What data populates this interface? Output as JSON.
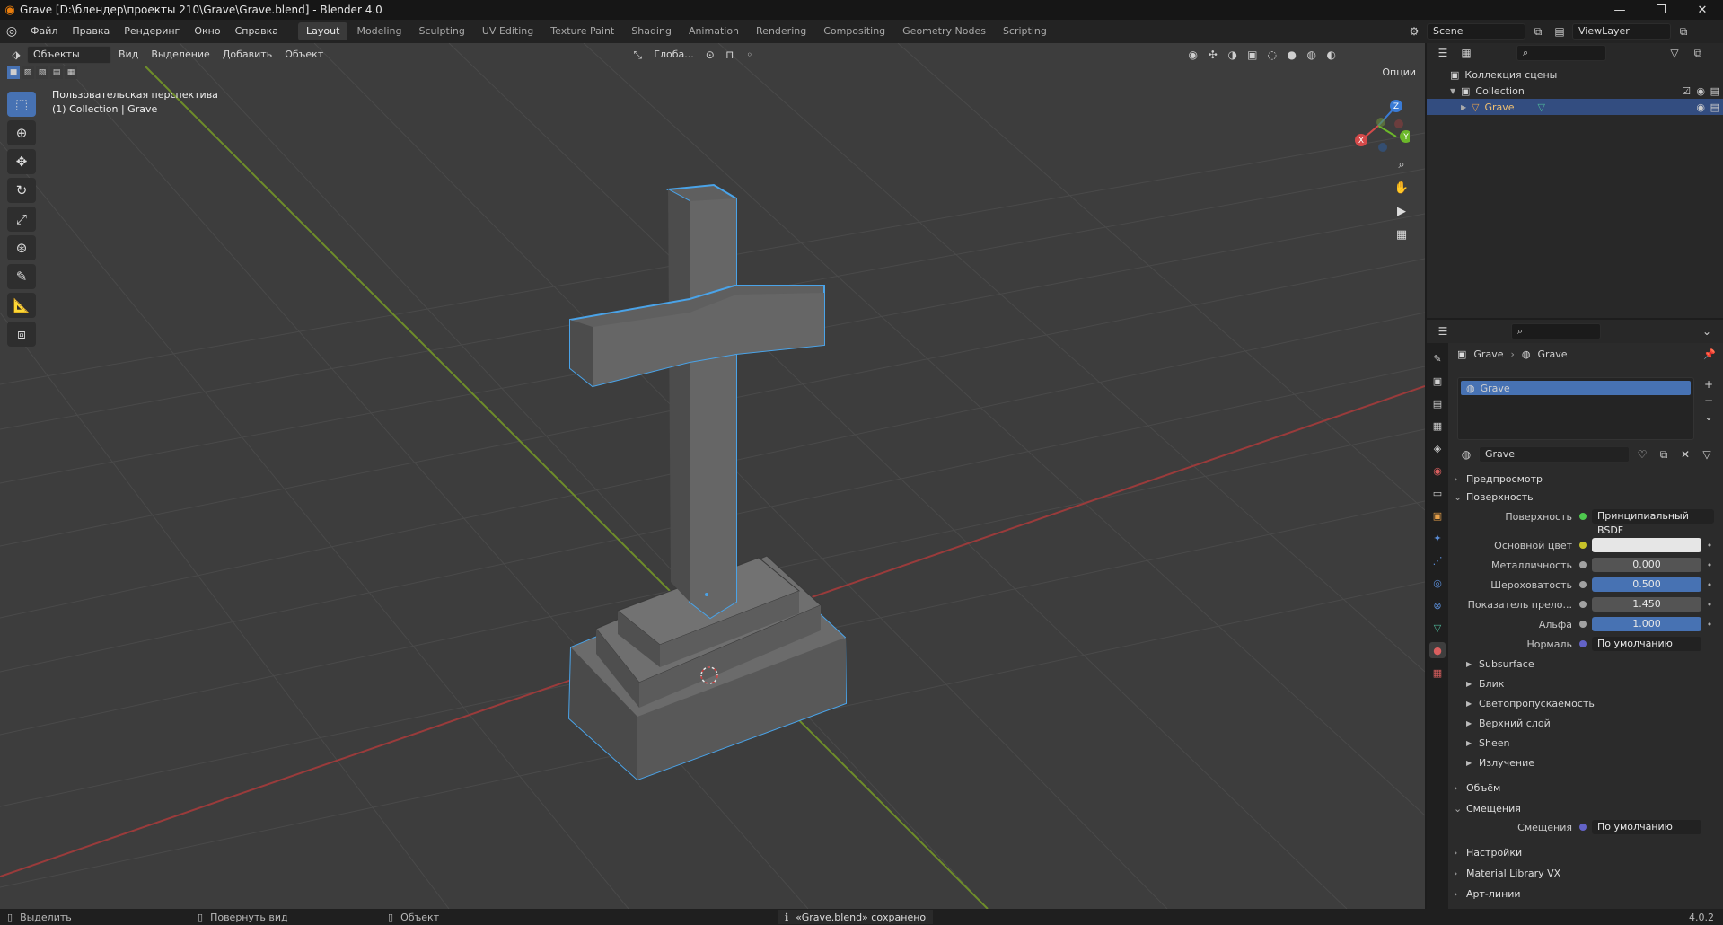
{
  "window": {
    "title": "Grave [D:\\блендер\\проекты 210\\Grave\\Grave.blend] - Blender 4.0",
    "minimize": "—",
    "maximize": "❐",
    "close": "✕"
  },
  "menu": [
    "Файл",
    "Правка",
    "Рендеринг",
    "Окно",
    "Справка"
  ],
  "workspaces": [
    {
      "label": "Layout",
      "active": true
    },
    {
      "label": "Modeling"
    },
    {
      "label": "Sculpting"
    },
    {
      "label": "UV Editing"
    },
    {
      "label": "Texture Paint"
    },
    {
      "label": "Shading"
    },
    {
      "label": "Animation"
    },
    {
      "label": "Rendering"
    },
    {
      "label": "Compositing"
    },
    {
      "label": "Geometry Nodes"
    },
    {
      "label": "Scripting"
    }
  ],
  "add_workspace": "+",
  "scene": {
    "name": "Scene",
    "view_layer": "ViewLayer"
  },
  "viewport": {
    "mode": "Объекты",
    "menus": [
      "Вид",
      "Выделение",
      "Добавить",
      "Объект"
    ],
    "orientation": "Глоба...",
    "perspective": "Пользовательская перспектива",
    "context": "(1) Collection | Grave",
    "options": "Опции",
    "gizmo_axes": {
      "x": "X",
      "y": "Y",
      "z": "Z"
    }
  },
  "outliner": {
    "root": "Коллекция сцены",
    "items": [
      {
        "label": "Collection"
      },
      {
        "label": "Grave",
        "selected": true
      }
    ]
  },
  "properties": {
    "breadcrumb": [
      "Grave",
      "Grave"
    ],
    "material_slot": "Grave",
    "material_name": "Grave",
    "sections": {
      "preview": "Предпросмотр",
      "surface": "Поверхность",
      "volume": "Объём",
      "displacement": "Смещения",
      "settings": "Настройки",
      "material_library": "Material Library VX",
      "lineart": "Арт-линии"
    },
    "surface_shader_label": "Поверхность",
    "surface_shader": "Принципиальный BSDF",
    "fields": [
      {
        "label": "Основной цвет",
        "value": "",
        "kind": "white",
        "dot": "#c7c229"
      },
      {
        "label": "Металличность",
        "value": "0.000",
        "kind": "plain",
        "dot": "#a1a1a1"
      },
      {
        "label": "Шероховатость",
        "value": "0.500",
        "kind": "blue",
        "dot": "#a1a1a1"
      },
      {
        "label": "Показатель прело...",
        "value": "1.450",
        "kind": "plain",
        "dot": "#a1a1a1"
      },
      {
        "label": "Альфа",
        "value": "1.000",
        "kind": "blue",
        "dot": "#a1a1a1"
      },
      {
        "label": "Нормаль",
        "value": "По умолчанию",
        "kind": "text",
        "dot": "#6363c7"
      }
    ],
    "subsections": [
      "Subsurface",
      "Блик",
      "Светопропускаемость",
      "Верхний слой",
      "Sheen",
      "Излучение"
    ],
    "displacement_label": "Смещения",
    "displacement_value": "По умолчанию"
  },
  "statusbar": {
    "select": "Выделить",
    "rotate": "Повернуть вид",
    "object": "Объект",
    "message": "«Grave.blend» сохранено",
    "version": "4.0.2"
  }
}
